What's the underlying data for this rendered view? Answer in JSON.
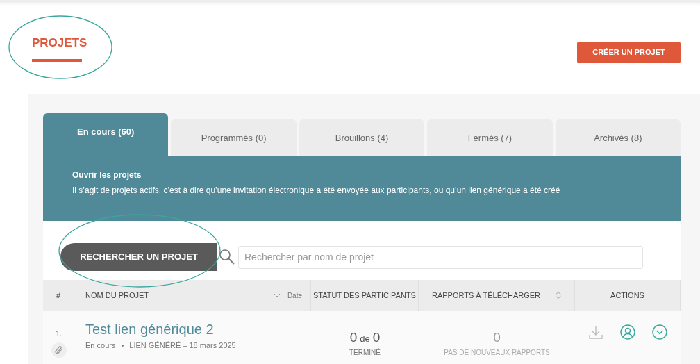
{
  "page_title": "PROJETS",
  "create_button": "CRÉER UN PROJET",
  "tabs": [
    {
      "label": "En cours (60)",
      "selected": true
    },
    {
      "label": "Programmés (0)",
      "selected": false
    },
    {
      "label": "Brouillons (4)",
      "selected": false
    },
    {
      "label": "Fermés (7)",
      "selected": false
    },
    {
      "label": "Archivés (8)",
      "selected": false
    }
  ],
  "info": {
    "title": "Ouvrir les projets",
    "text": "Il s’agit de projets actifs, c’est à dire qu’une invitation électronique a été envoyée aux participants, ou qu’un lien générique a été créé"
  },
  "search": {
    "button": "RECHERCHER UN PROJET",
    "placeholder": "Rechercher par nom de projet"
  },
  "table": {
    "columns": [
      "#",
      "NOM DU PROJET",
      "STATUT DES PARTICIPANTS",
      "RAPPORTS À TÉLÉCHARGER",
      "ACTIONS"
    ],
    "date_sort": "Date",
    "rows": [
      {
        "number": "1.",
        "name": "Test lien générique 2",
        "status": "En cours",
        "separator": "•",
        "link_info": "LIEN GÉNÉRÉ – 18 mars 2025",
        "done": "0",
        "of": "de",
        "total": "0",
        "participants_label": "TERMINÉ",
        "reports": "0",
        "reports_label": "PAS DE NOUVEAUX RAPPORTS"
      }
    ]
  }
}
